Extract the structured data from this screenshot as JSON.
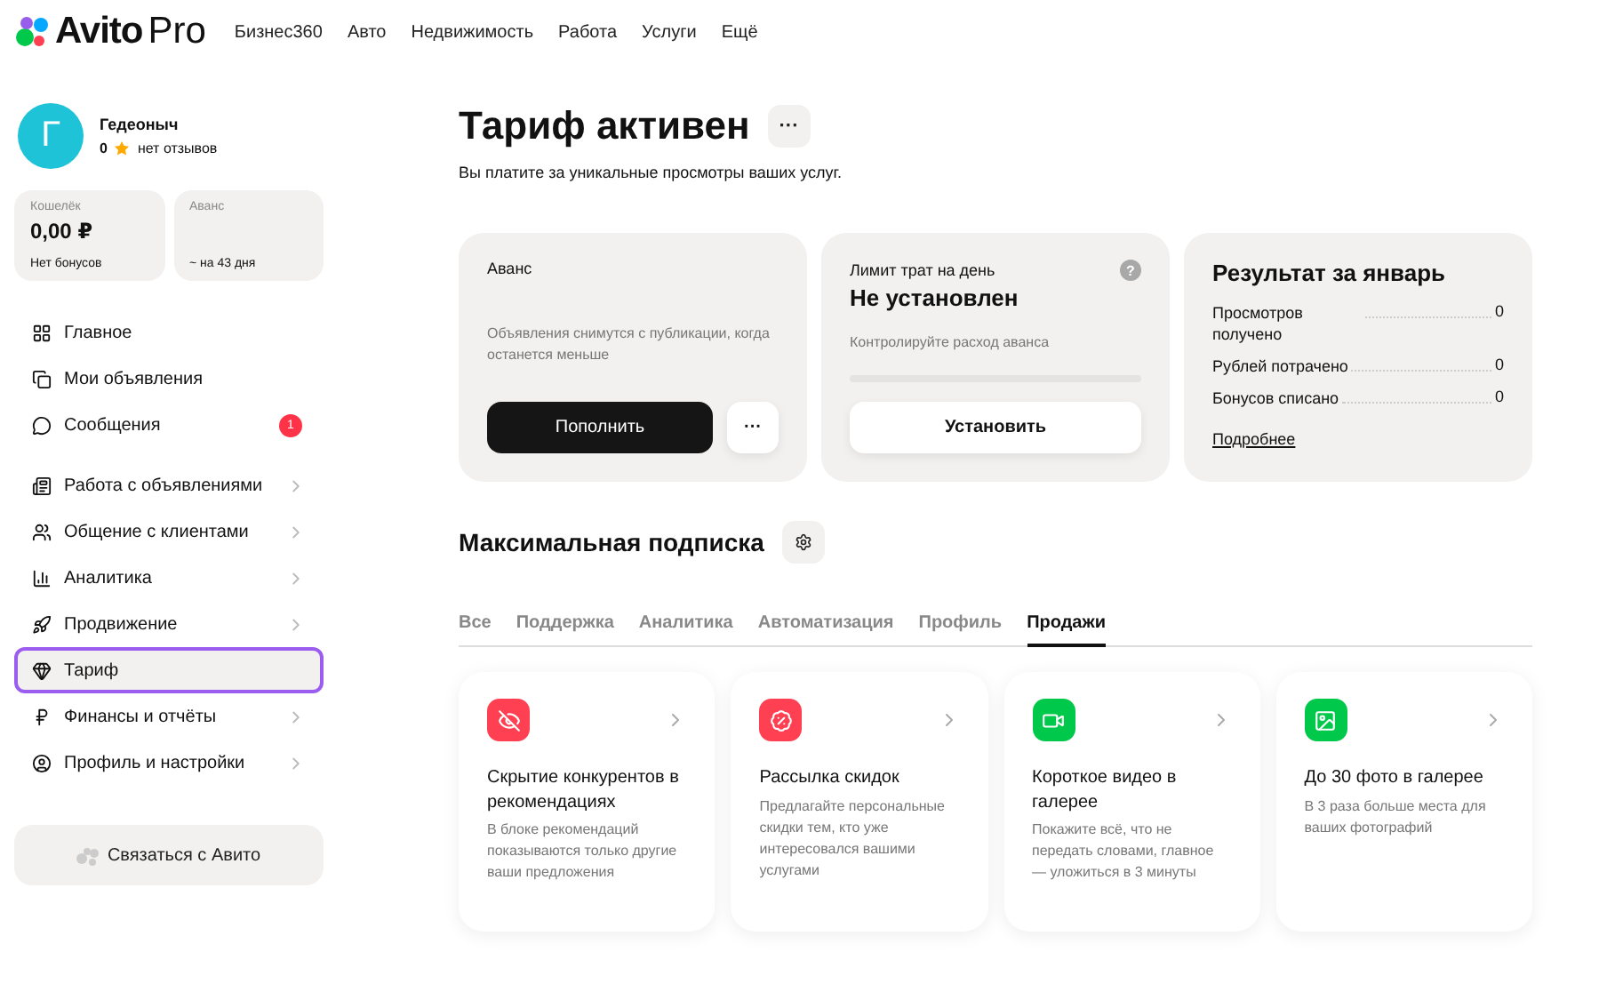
{
  "header": {
    "logo": {
      "brand": "Avito",
      "suffix": "Pro"
    },
    "links": [
      "Бизнес360",
      "Авто",
      "Недвижимость",
      "Работа",
      "Услуги",
      "Ещё"
    ]
  },
  "profile": {
    "initial": "Г",
    "name": "Гедеоныч",
    "rating": "0",
    "reviews": "нет отзывов"
  },
  "wallets": [
    {
      "label": "Кошелёк",
      "value": "0,00 ₽",
      "note": "Нет бонусов"
    },
    {
      "label": "Аванс",
      "note": "~ на 43 дня"
    }
  ],
  "nav": [
    {
      "items": [
        {
          "label": "Главное",
          "submenu": false,
          "selected": false
        },
        {
          "label": "Мои объявления",
          "submenu": false,
          "selected": false
        },
        {
          "label": "Сообщения",
          "submenu": false,
          "selected": false,
          "badge": "1"
        }
      ]
    },
    {
      "items": [
        {
          "label": "Работа с объявлениями",
          "submenu": true,
          "selected": false
        },
        {
          "label": "Общение с клиентами",
          "submenu": true,
          "selected": false
        },
        {
          "label": "Аналитика",
          "submenu": true,
          "selected": false
        },
        {
          "label": "Продвижение",
          "submenu": true,
          "selected": false
        },
        {
          "label": "Тариф",
          "submenu": false,
          "selected": true
        },
        {
          "label": "Финансы и отчёты",
          "submenu": true,
          "selected": false
        },
        {
          "label": "Профиль и настройки",
          "submenu": true,
          "selected": false
        }
      ]
    }
  ],
  "contact_button": "Связаться с Авито",
  "page": {
    "title": "Тариф активен",
    "more_button": "···",
    "subtitle": "Вы платите за уникальные просмотры ваших услуг."
  },
  "advance_card": {
    "title": "Аванс",
    "text": "Объявления снимутся с публикации, когда останется меньше",
    "button": "Пополнить",
    "more_button": "···"
  },
  "limit_card": {
    "label": "Лимит трат на день",
    "value": "Не установлен",
    "hint": "Контролируйте расход аванса",
    "button": "Установить",
    "help": "?"
  },
  "result_card": {
    "title": "Результат за январь",
    "rows": [
      {
        "label": "Просмотров получено",
        "value": "0"
      },
      {
        "label": "Рублей потрачено",
        "value": "0"
      },
      {
        "label": "Бонусов списано",
        "value": "0"
      }
    ],
    "link": "Подробнее"
  },
  "subscription": {
    "title": "Максимальная подписка",
    "tabs": [
      {
        "label": "Все",
        "selected": false
      },
      {
        "label": "Поддержка",
        "selected": false
      },
      {
        "label": "Аналитика",
        "selected": false
      },
      {
        "label": "Автоматизация",
        "selected": false
      },
      {
        "label": "Профиль",
        "selected": false
      },
      {
        "label": "Продажи",
        "selected": true
      }
    ],
    "services": [
      {
        "title": "Скрытие конкурентов в рекомендациях",
        "text": "В блоке рекомендаций показываются только другие ваши предложения",
        "color": "#ff4053"
      },
      {
        "title": "Рассылка скидок",
        "text": "Предлагайте персональные скидки тем, кто уже интересовался вашими услугами",
        "color": "#ff4053"
      },
      {
        "title": "Короткое видео в галерее",
        "text": "Покажите всё, что не передать словами, главное — уложиться в 3 минуты",
        "color": "#00c84a"
      },
      {
        "title": "До 30 фото в галерее",
        "text": "В 3 раза больше места для ваших фотографий",
        "color": "#00c84a"
      }
    ]
  }
}
